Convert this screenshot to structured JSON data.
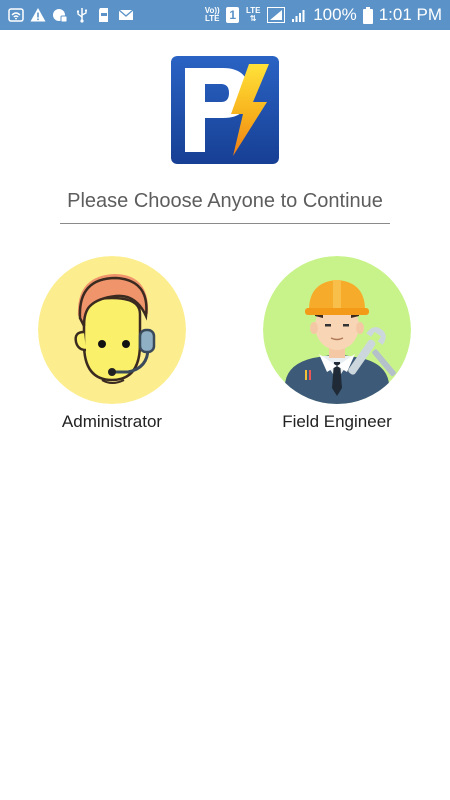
{
  "status_bar": {
    "icons_left": [
      "wifi-icon",
      "warning-icon",
      "data-saver-icon",
      "usb-icon",
      "sd-card-icon",
      "mail-icon"
    ],
    "volte_top": "Vo))",
    "volte_bottom": "LTE",
    "sim_number": "1",
    "lte_label": "LTE",
    "battery_percent": "100%",
    "time": "1:01 PM",
    "background_color": "#5b93c8"
  },
  "logo": {
    "icon": "app-logo-p-bolt",
    "colors": {
      "blue": "#1e4fa8",
      "yellow": "#f5c518",
      "orange": "#f08a1c"
    }
  },
  "heading": {
    "text": "Please Choose Anyone to Continue"
  },
  "roles": {
    "admin": {
      "label": "Administrator",
      "icon": "administrator-headset-avatar",
      "circle_color": "#fcee8e"
    },
    "engineer": {
      "label": "Field Engineer",
      "icon": "field-engineer-hardhat-avatar",
      "circle_color": "#c8f38a"
    }
  }
}
